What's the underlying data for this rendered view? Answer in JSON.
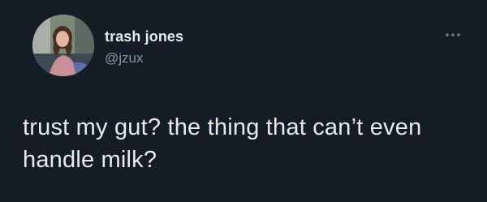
{
  "tweet": {
    "author": {
      "display_name": "trash jones",
      "handle": "@jzux",
      "avatar_icon": "profile-photo"
    },
    "more_icon": "more-horizontal-icon",
    "text_lines": [
      "trust my gut? the thing that can’t even",
      "handle milk?"
    ]
  },
  "colors": {
    "background": "#141c26",
    "primary_text": "#e7e9ea",
    "secondary_text": "#8b98a5"
  }
}
